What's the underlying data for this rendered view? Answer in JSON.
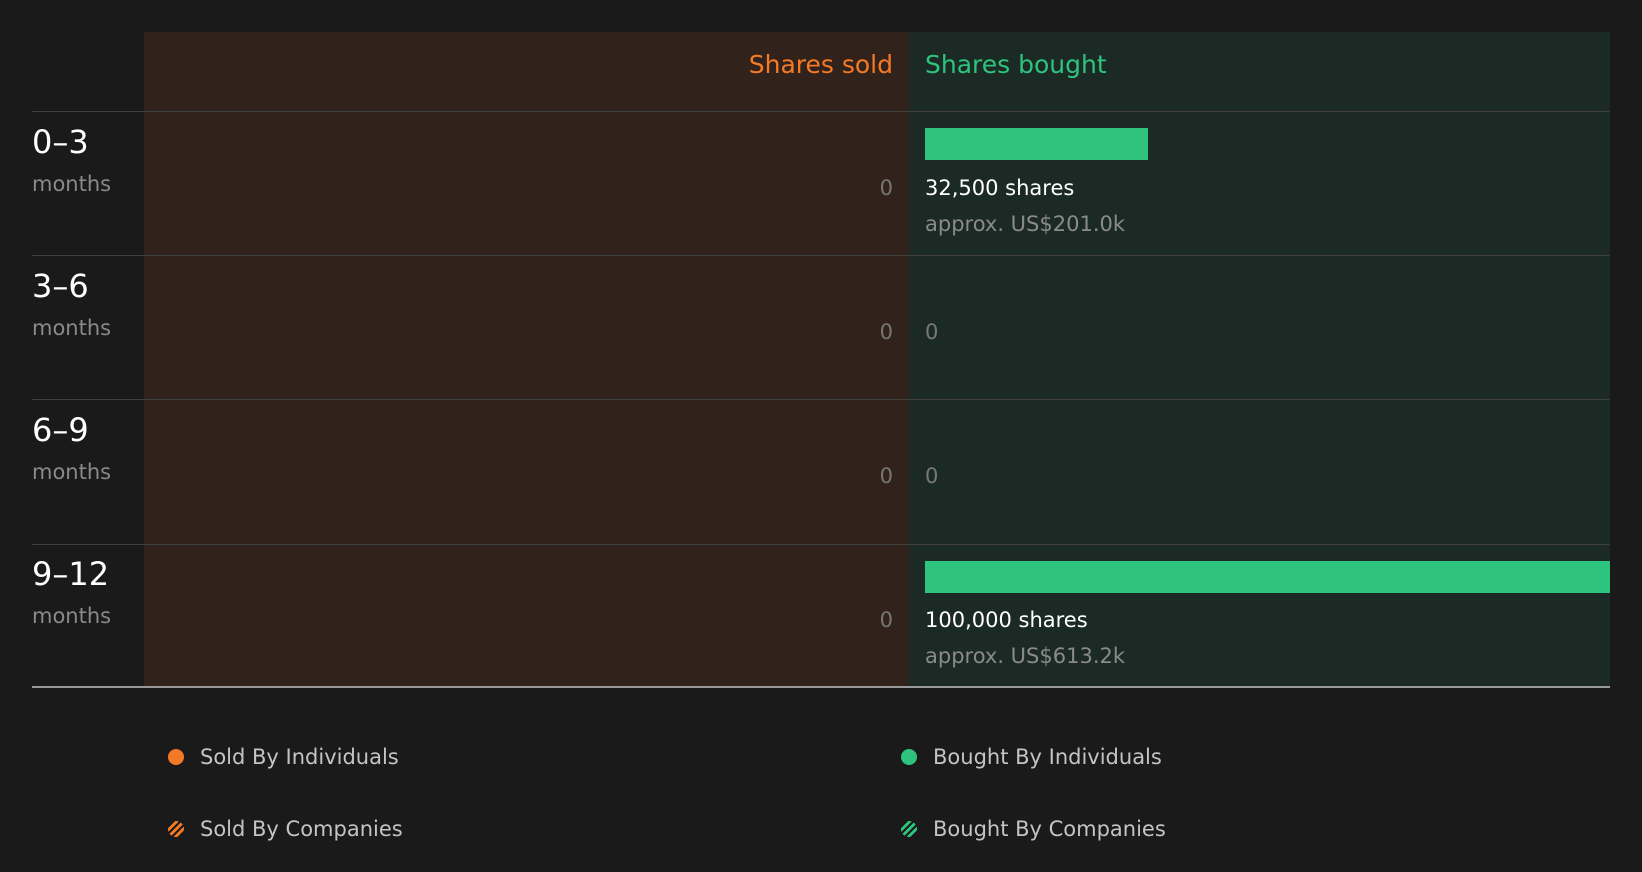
{
  "chart_data": {
    "type": "bar",
    "headers": {
      "sold": "Shares sold",
      "bought": "Shares bought"
    },
    "categories": [
      {
        "range": "0–3",
        "unit": "months"
      },
      {
        "range": "3–6",
        "unit": "months"
      },
      {
        "range": "6–9",
        "unit": "months"
      },
      {
        "range": "9–12",
        "unit": "months"
      }
    ],
    "series": [
      {
        "name": "Shares sold",
        "values": [
          0,
          0,
          0,
          0
        ],
        "labels": [
          "0",
          "0",
          "0",
          "0"
        ]
      },
      {
        "name": "Shares bought",
        "values": [
          32500,
          0,
          0,
          100000
        ],
        "labels": [
          "32,500 shares",
          "0",
          "0",
          "100,000 shares"
        ],
        "approx": [
          "approx. US$201.0k",
          "",
          "",
          "approx. US$613.2k"
        ]
      }
    ],
    "bought_max": 100000,
    "legend": [
      {
        "label": "Sold By Individuals",
        "color": "#f57a25",
        "pattern": "solid"
      },
      {
        "label": "Bought By Individuals",
        "color": "#2ec47d",
        "pattern": "solid"
      },
      {
        "label": "Sold By Companies",
        "color": "#f57a25",
        "pattern": "hatched"
      },
      {
        "label": "Bought By Companies",
        "color": "#2ec47d",
        "pattern": "hatched"
      }
    ],
    "colors": {
      "sold": "#f57a25",
      "bought": "#2ec47d",
      "sold_background": "#31231c",
      "bought_background": "#1b2a24"
    }
  }
}
